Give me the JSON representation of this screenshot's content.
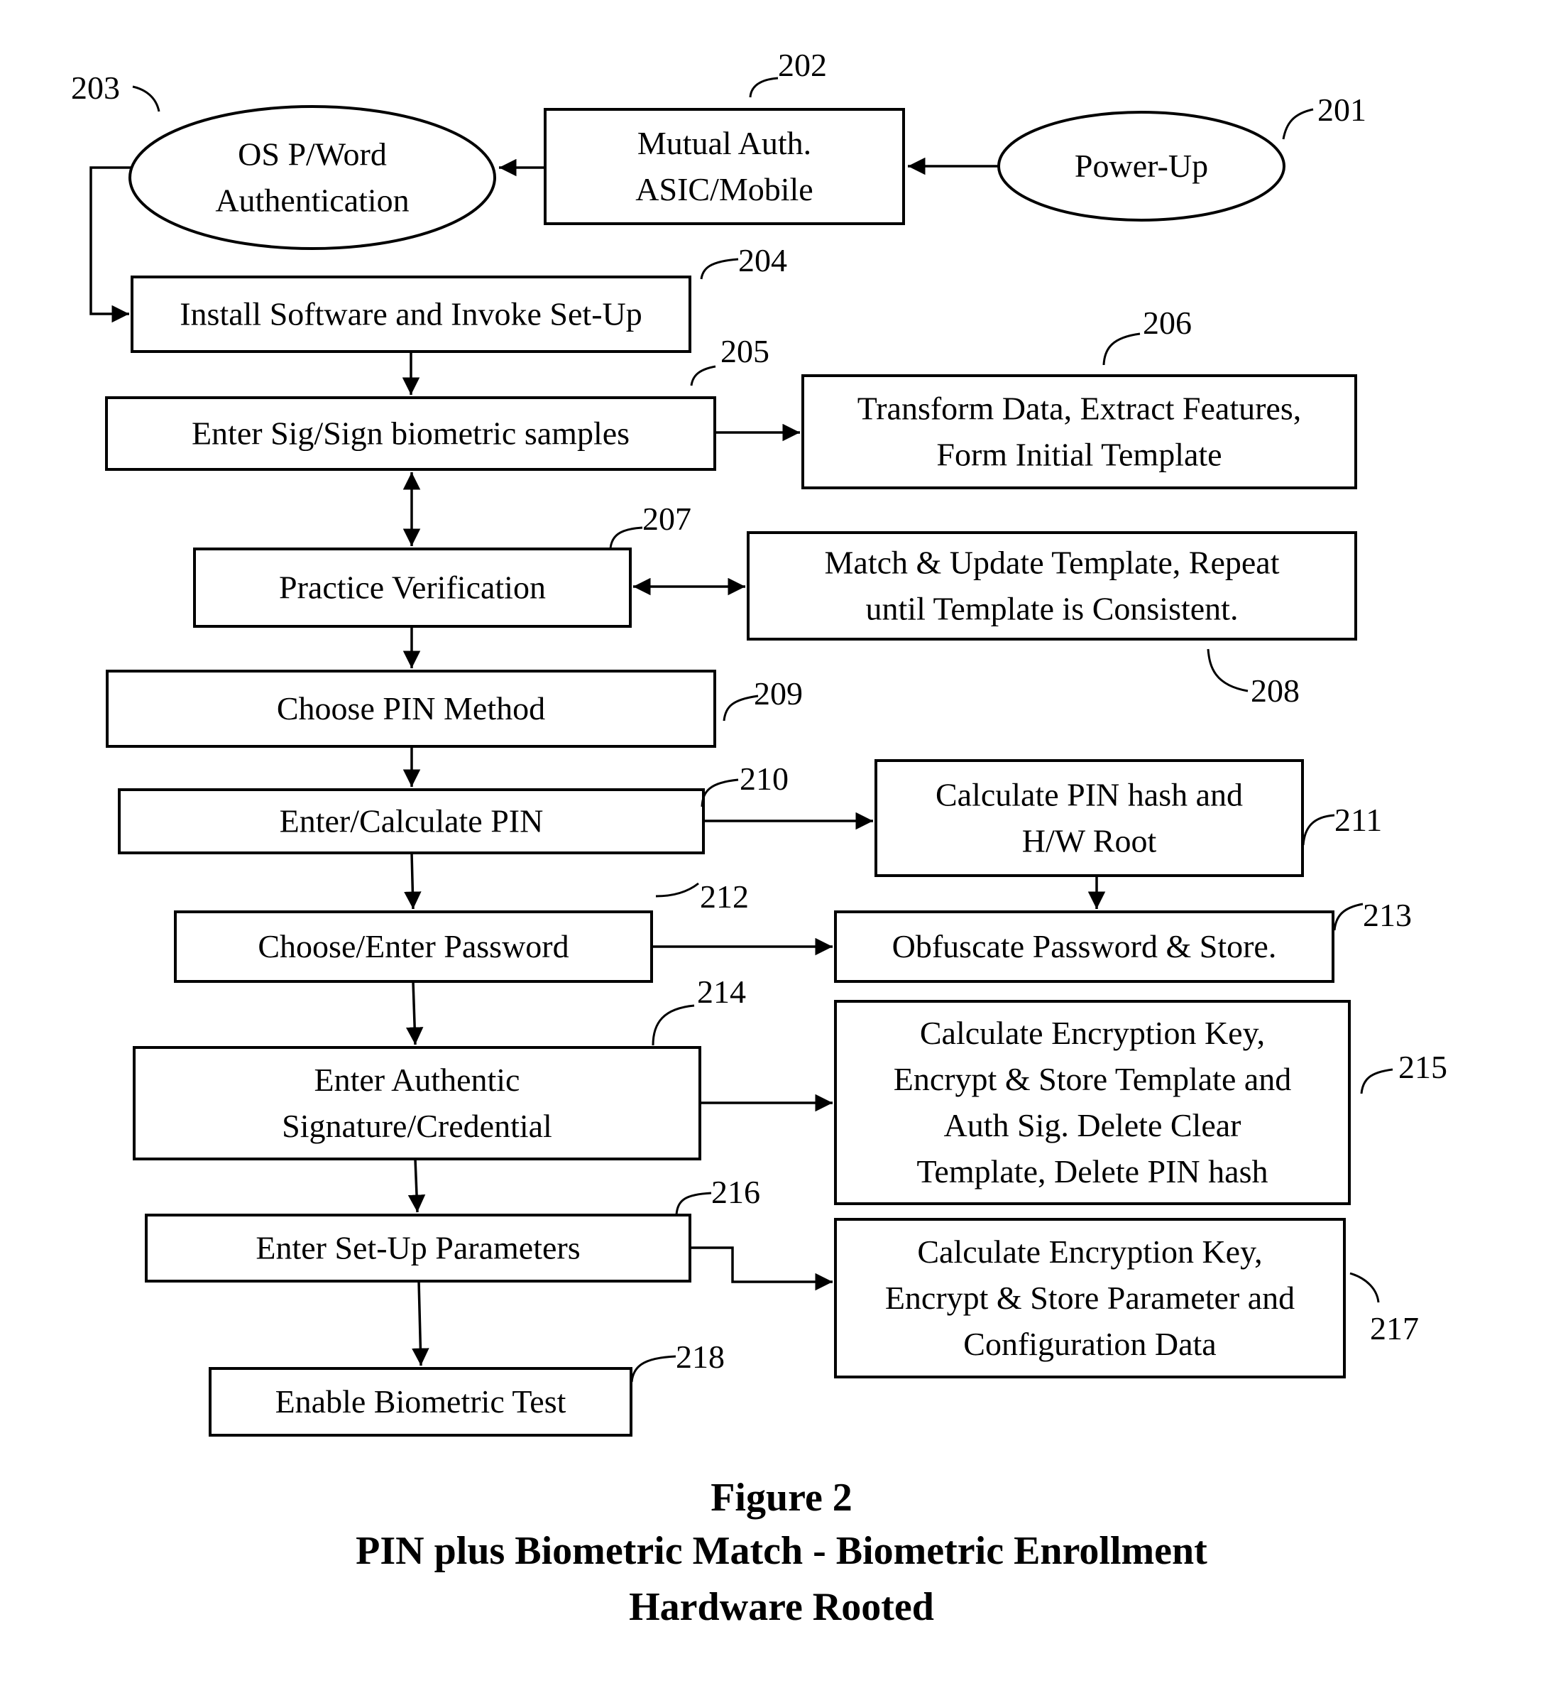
{
  "figure": {
    "number_label": "Figure 2",
    "title_line1": "PIN plus Biometric Match - Biometric Enrollment",
    "title_line2": "Hardware Rooted"
  },
  "nodes": [
    {
      "id": "201",
      "shape": "ellipse",
      "lines": [
        "Power-Up"
      ]
    },
    {
      "id": "202",
      "shape": "rect",
      "lines": [
        "Mutual Auth.",
        "ASIC/Mobile"
      ]
    },
    {
      "id": "203",
      "shape": "ellipse",
      "lines": [
        "OS P/Word",
        "Authentication"
      ]
    },
    {
      "id": "204",
      "shape": "rect",
      "lines": [
        "Install Software and Invoke Set-Up"
      ]
    },
    {
      "id": "205",
      "shape": "rect",
      "lines": [
        "Enter Sig/Sign biometric samples"
      ]
    },
    {
      "id": "206",
      "shape": "rect",
      "lines": [
        "Transform Data, Extract Features,",
        "Form Initial Template"
      ]
    },
    {
      "id": "207",
      "shape": "rect",
      "lines": [
        "Practice Verification"
      ]
    },
    {
      "id": "208",
      "shape": "rect",
      "lines": [
        "Match & Update Template, Repeat",
        "until Template is Consistent."
      ]
    },
    {
      "id": "209",
      "shape": "rect",
      "lines": [
        "Choose PIN Method"
      ]
    },
    {
      "id": "210",
      "shape": "rect",
      "lines": [
        "Enter/Calculate PIN"
      ]
    },
    {
      "id": "211",
      "shape": "rect",
      "lines": [
        "Calculate PIN hash and",
        "H/W Root"
      ]
    },
    {
      "id": "212",
      "shape": "rect",
      "lines": [
        "Choose/Enter Password"
      ]
    },
    {
      "id": "213",
      "shape": "rect",
      "lines": [
        "Obfuscate Password & Store."
      ]
    },
    {
      "id": "214",
      "shape": "rect",
      "lines": [
        "Enter Authentic",
        "Signature/Credential"
      ]
    },
    {
      "id": "215",
      "shape": "rect",
      "lines": [
        "Calculate Encryption Key,",
        "Encrypt & Store Template and",
        "Auth Sig. Delete Clear",
        "Template, Delete PIN hash"
      ]
    },
    {
      "id": "216",
      "shape": "rect",
      "lines": [
        "Enter Set-Up Parameters"
      ]
    },
    {
      "id": "217",
      "shape": "rect",
      "lines": [
        "Calculate Encryption Key,",
        "Encrypt & Store Parameter and",
        "Configuration Data"
      ]
    },
    {
      "id": "218",
      "shape": "rect",
      "lines": [
        "Enable Biometric Test"
      ]
    }
  ],
  "edges": [
    {
      "from": "201",
      "to": "202",
      "direction": "forward"
    },
    {
      "from": "202",
      "to": "203",
      "direction": "forward"
    },
    {
      "from": "203",
      "to": "204",
      "direction": "forward"
    },
    {
      "from": "204",
      "to": "205",
      "direction": "forward"
    },
    {
      "from": "205",
      "to": "206",
      "direction": "forward"
    },
    {
      "from": "205",
      "to": "207",
      "direction": "both"
    },
    {
      "from": "207",
      "to": "208",
      "direction": "both"
    },
    {
      "from": "207",
      "to": "209",
      "direction": "forward"
    },
    {
      "from": "209",
      "to": "210",
      "direction": "forward"
    },
    {
      "from": "210",
      "to": "211",
      "direction": "forward"
    },
    {
      "from": "211",
      "to": "213",
      "direction": "forward"
    },
    {
      "from": "210",
      "to": "212",
      "direction": "forward"
    },
    {
      "from": "212",
      "to": "213",
      "direction": "forward"
    },
    {
      "from": "212",
      "to": "214",
      "direction": "forward"
    },
    {
      "from": "214",
      "to": "215",
      "direction": "forward"
    },
    {
      "from": "214",
      "to": "216",
      "direction": "forward"
    },
    {
      "from": "216",
      "to": "217",
      "direction": "forward"
    },
    {
      "from": "216",
      "to": "218",
      "direction": "forward"
    }
  ]
}
